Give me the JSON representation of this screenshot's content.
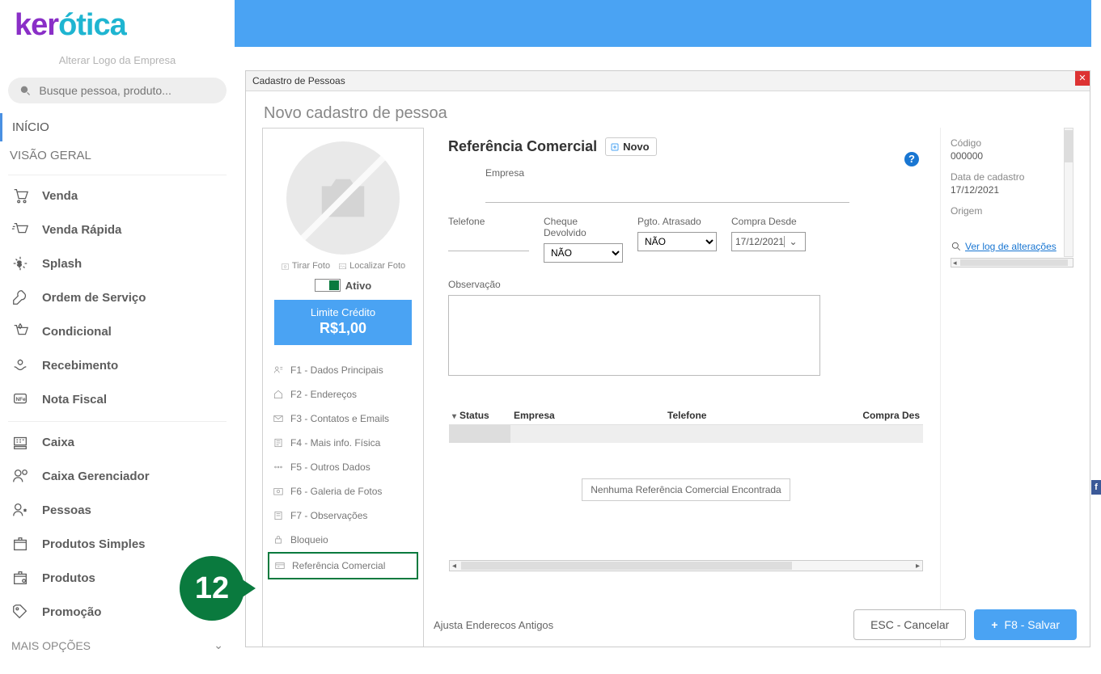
{
  "logo": {
    "part1": "ker",
    "part2": "ótica",
    "tagline": "Alterar Logo da Empresa"
  },
  "search": {
    "placeholder": "Busque pessoa, produto..."
  },
  "nav": {
    "inicio": "INÍCIO",
    "visao": "VISÃO GERAL",
    "g1": [
      "Venda",
      "Venda Rápida",
      "Splash",
      "Ordem de Serviço",
      "Condicional",
      "Recebimento",
      "Nota Fiscal"
    ],
    "g2": [
      "Caixa",
      "Caixa Gerenciador",
      "Pessoas",
      "Produtos Simples",
      "Produtos",
      "Promoção"
    ],
    "more": "MAIS OPÇÕES"
  },
  "step": "12",
  "modal": {
    "wtitle": "Cadastro de Pessoas",
    "heading": "Novo cadastro de pessoa",
    "left": {
      "tirar": "Tirar Foto",
      "localizar": "Localizar Foto",
      "ativo": "Ativo",
      "credit_lbl": "Limite Crédito",
      "credit_val": "R$1,00",
      "tabs": [
        "F1 - Dados Principais",
        "F2 - Endereços",
        "F3 - Contatos e Emails",
        "F4 - Mais info. Física",
        "F5 - Outros Dados",
        "F6 - Galeria de Fotos",
        "F7 - Observações",
        "Bloqueio",
        "Referência Comercial"
      ]
    },
    "center": {
      "title": "Referência Comercial",
      "novo": "Novo",
      "empresa_lbl": "Empresa",
      "telefone_lbl": "Telefone",
      "cheque_lbl": "Cheque Devolvido",
      "pgto_lbl": "Pgto. Atrasado",
      "compra_lbl": "Compra Desde",
      "nao": "NÃO",
      "date": "17/12/2021",
      "obs_lbl": "Observação",
      "cols": {
        "status": "Status",
        "empresa": "Empresa",
        "telefone": "Telefone",
        "compra": "Compra Des"
      },
      "empty": "Nenhuma Referência Comercial Encontrada"
    },
    "right": {
      "codigo_lbl": "Código",
      "codigo_val": "000000",
      "datacad_lbl": "Data de cadastro",
      "datacad_val": "17/12/2021",
      "origem_lbl": "Origem",
      "log": "Ver log de alterações"
    },
    "footer": {
      "ajusta": "Ajusta Enderecos Antigos",
      "cancel": "ESC - Cancelar",
      "save": "F8 - Salvar"
    }
  }
}
